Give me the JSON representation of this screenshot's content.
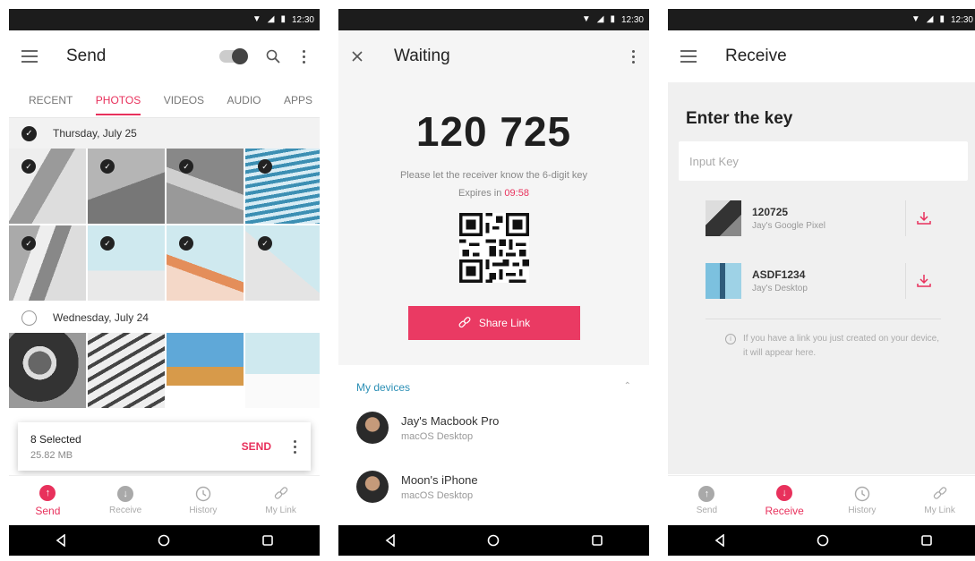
{
  "status": {
    "time": "12:30"
  },
  "send_screen": {
    "title": "Send",
    "tabs": [
      "RECENT",
      "PHOTOS",
      "VIDEOS",
      "AUDIO",
      "APPS"
    ],
    "active_tab": "PHOTOS",
    "groups": [
      {
        "date": "Thursday, July 25",
        "checked": true
      },
      {
        "date": "Wednesday, July 24",
        "checked": false
      }
    ],
    "selection": {
      "count": "8 Selected",
      "size": "25.82 MB",
      "action": "SEND"
    },
    "bottom_nav": [
      "Send",
      "Receive",
      "History",
      "My Link"
    ]
  },
  "waiting_screen": {
    "title": "Waiting",
    "key": "120 725",
    "instruction": "Please let the receiver know the 6-digit key",
    "expires_label": "Expires in",
    "expires_value": "09:58",
    "share_label": "Share Link",
    "devices_title": "My devices",
    "devices": [
      {
        "name": "Jay's Macbook Pro",
        "type": "macOS Desktop"
      },
      {
        "name": "Moon's iPhone",
        "type": "macOS Desktop"
      }
    ]
  },
  "receive_screen": {
    "title": "Receive",
    "heading": "Enter the key",
    "input_placeholder": "Input Key",
    "keys": [
      {
        "key": "120725",
        "device": "Jay's Google Pixel"
      },
      {
        "key": "ASDF1234",
        "device": "Jay's Desktop"
      }
    ],
    "hint": "If you have a link you just created on your device, it will appear here.",
    "bottom_nav": [
      "Send",
      "Receive",
      "History",
      "My Link"
    ]
  },
  "colors": {
    "accent": "#e8315c",
    "link": "#2b8fb5"
  }
}
